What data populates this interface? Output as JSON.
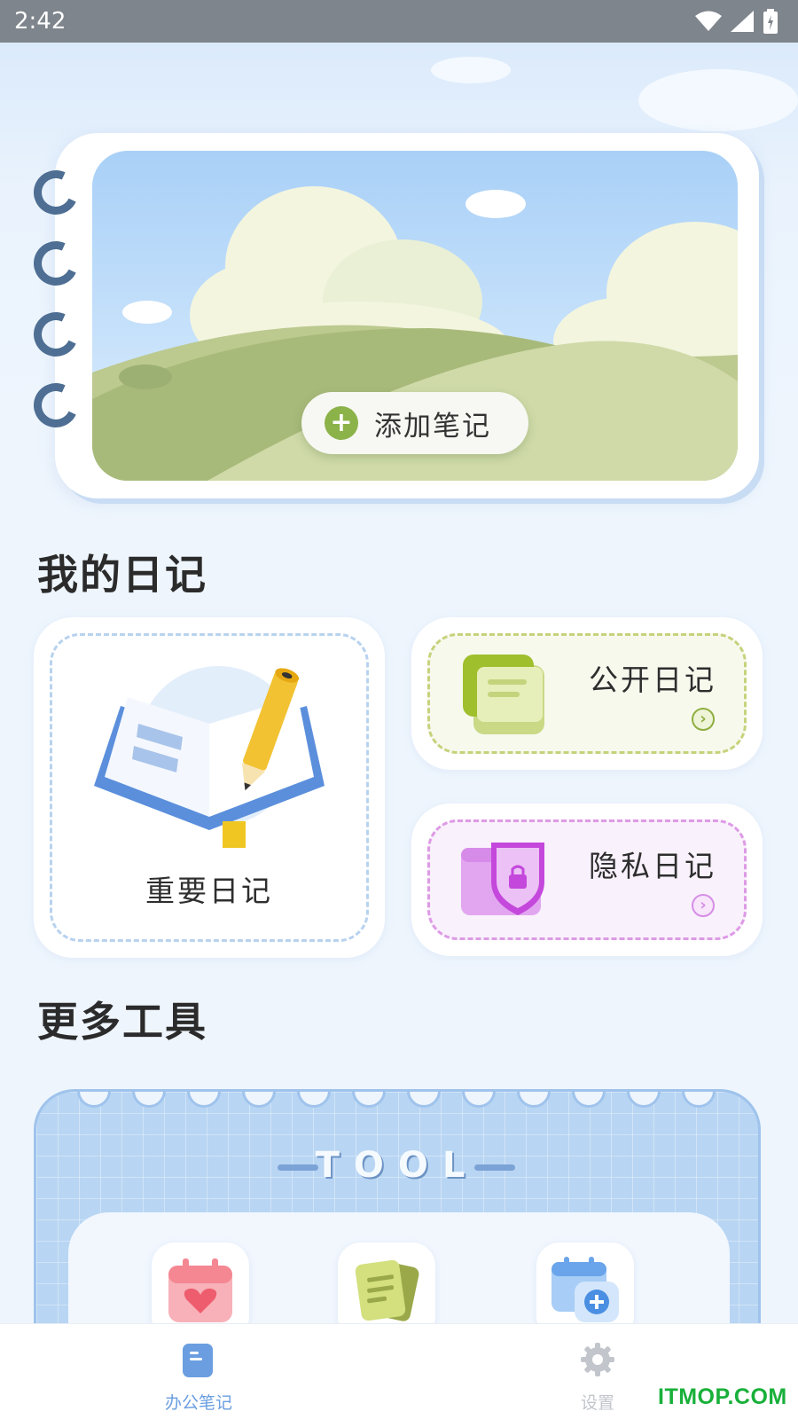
{
  "status_bar": {
    "time": "2:42"
  },
  "hero": {
    "add_note_label": "添加笔记"
  },
  "diary_section": {
    "title": "我的日记",
    "important": {
      "label": "重要日记"
    },
    "public": {
      "label": "公开日记"
    },
    "private": {
      "label": "隐私日记"
    }
  },
  "tools_section": {
    "title": "更多工具",
    "heading": "TOOL",
    "icons": [
      "calendar-heart-icon",
      "notes-icon",
      "calendar-add-icon"
    ]
  },
  "bottom_nav": {
    "items": [
      {
        "label": "办公笔记",
        "icon": "notebook-icon",
        "active": true
      },
      {
        "label": "设置",
        "icon": "gear-icon",
        "active": false
      }
    ]
  },
  "watermark": "ITMOP.COM",
  "colors": {
    "accent_blue": "#6a9ee0",
    "green": "#8cb34a",
    "purple": "#d77ee8",
    "inactive": "#c2c6cc"
  }
}
